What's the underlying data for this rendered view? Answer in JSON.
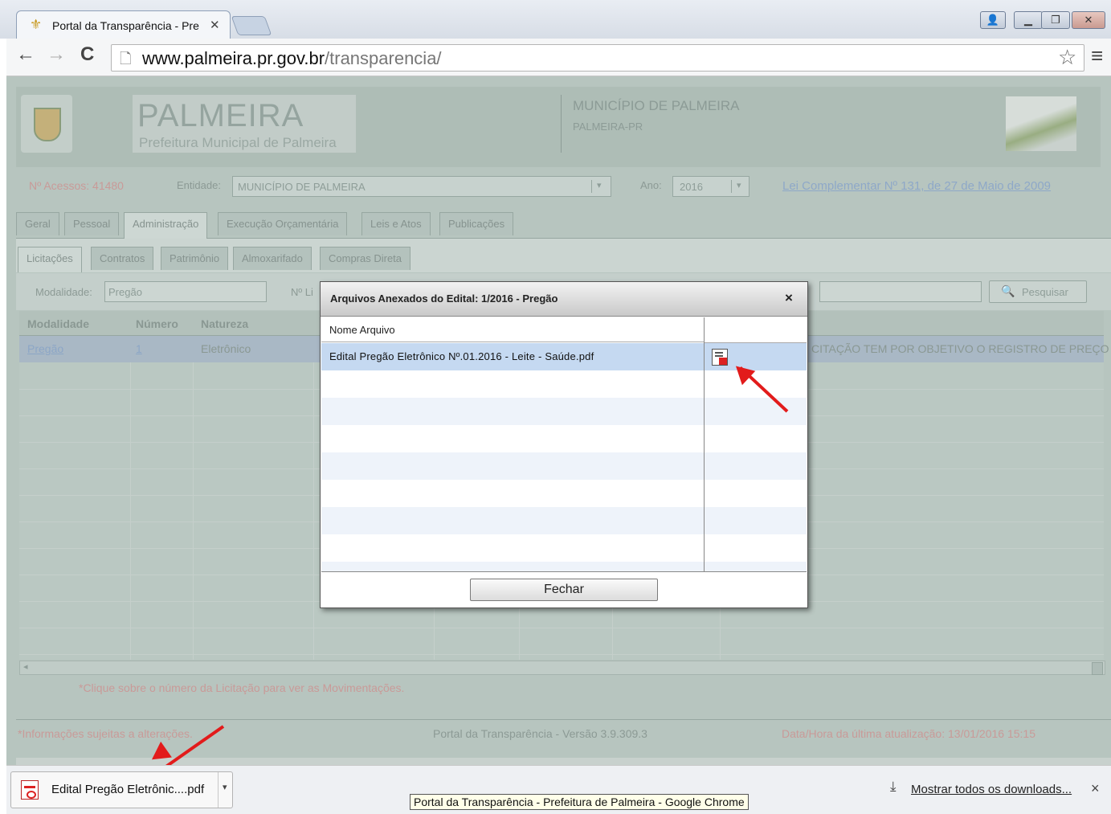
{
  "browser": {
    "tab_title": "Portal da Transparência - Pre",
    "tab_close": "✕",
    "url_domain": "www.palmeira.pr.gov.br",
    "url_path": "/transparencia/",
    "win_user": "👤",
    "win_min": "▁",
    "win_max": "❐",
    "win_close": "✕",
    "back": "←",
    "forward": "→",
    "reload": "C",
    "star": "☆",
    "menu": "≡"
  },
  "header": {
    "logo_title": "PALMEIRA",
    "logo_subtitle": "Prefeitura Municipal de Palmeira",
    "municipio": "MUNICÍPIO DE PALMEIRA",
    "uf": "PALMEIRA-PR"
  },
  "filters": {
    "acessos": "Nº Acessos: 41480",
    "entidade_label": "Entidade:",
    "entidade_value": "MUNICÍPIO DE PALMEIRA",
    "ano_label": "Ano:",
    "ano_value": "2016",
    "lei_link": "Lei Complementar Nº 131, de 27 de Maio de 2009"
  },
  "main_tabs": [
    "Geral",
    "Pessoal",
    "Administração",
    "Execução Orçamentária",
    "Leis e Atos",
    "Publicações"
  ],
  "sub_tabs": [
    "Licitações",
    "Contratos",
    "Patrimônio",
    "Almoxarifado",
    "Compras Direta"
  ],
  "search": {
    "modalidade_label": "Modalidade:",
    "modalidade_value": "Pregão",
    "numero_label": "Nº Li",
    "pesquisar": "Pesquisar"
  },
  "table": {
    "headers": [
      "Modalidade",
      "Número",
      "Natureza"
    ],
    "row": {
      "modalidade": "Pregão",
      "numero": "1",
      "natureza": "Eletrônico",
      "objeto": "CITAÇÃO TEM POR OBJETIVO O REGISTRO DE PREÇO V"
    }
  },
  "page_notes": {
    "click_hint": "*Clique sobre o número da Licitação para ver as Movimentações.",
    "footer_left": "*Informações sujeitas a alterações.",
    "footer_center": "Portal da Transparência - Versão 3.9.309.3",
    "footer_right": "Data/Hora da última atualização: 13/01/2016 15:15"
  },
  "dialog": {
    "title": "Arquivos Anexados do Edital: 1/2016 - Pregão",
    "close": "×",
    "col_name": "Nome Arquivo",
    "file_name": "Edital Pregão Eletrônico Nº.01.2016 - Leite - Saúde.pdf",
    "fechar": "Fechar"
  },
  "downloads": {
    "item": "Edital Pregão Eletrônic....pdf",
    "show_all": "Mostrar todos os downloads...",
    "close": "×",
    "tooltip": "Portal da Transparência - Prefeitura de Palmeira - Google Chrome"
  },
  "colors": {
    "annotation_arrow": "#e21b1b",
    "page_bg": "#b7c5bf",
    "selected_row": "#c5d9f1"
  }
}
